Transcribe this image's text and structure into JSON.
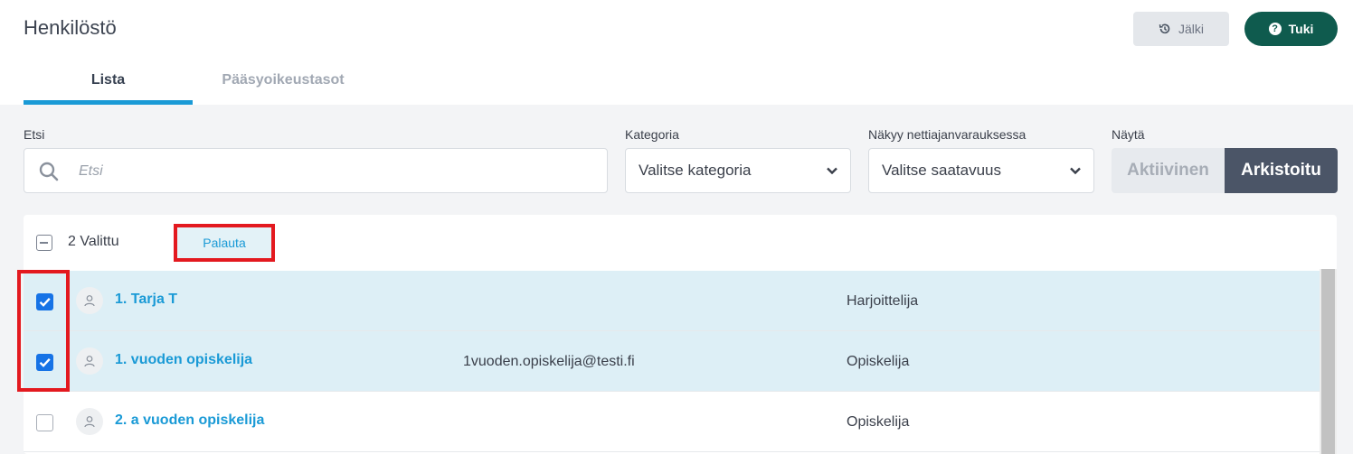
{
  "header": {
    "title": "Henkilöstö",
    "jalki_label": "Jälki",
    "tuki_label": "Tuki"
  },
  "tabs": [
    {
      "label": "Lista",
      "active": true
    },
    {
      "label": "Pääsyoikeustasot",
      "active": false
    }
  ],
  "filters": {
    "search_label": "Etsi",
    "search_placeholder": "Etsi",
    "search_value": "",
    "category_label": "Kategoria",
    "category_value": "Valitse kategoria",
    "visibility_label": "Näkyy nettiajanvarauksessa",
    "visibility_value": "Valitse saatavuus",
    "show_label": "Näytä",
    "show_options": [
      "Aktiivinen",
      "Arkistoitu"
    ],
    "show_selected": "Arkistoitu"
  },
  "selection": {
    "count_text": "2 Valittu",
    "restore_label": "Palauta"
  },
  "rows": [
    {
      "name": "1. Tarja T",
      "email": "",
      "role": "Harjoittelija",
      "checked": true
    },
    {
      "name": "1. vuoden opiskelija",
      "email": "1vuoden.opiskelija@testi.fi",
      "role": "Opiskelija",
      "checked": true
    },
    {
      "name": "2. a vuoden opiskelija",
      "email": "",
      "role": "Opiskelija",
      "checked": false
    }
  ],
  "colors": {
    "accent": "#1a9ad6",
    "tuki_button": "#0f5b4e",
    "checkbox_checked": "#1673e6",
    "selected_row": "#ddeff6",
    "annotation_red": "#e3191f"
  }
}
